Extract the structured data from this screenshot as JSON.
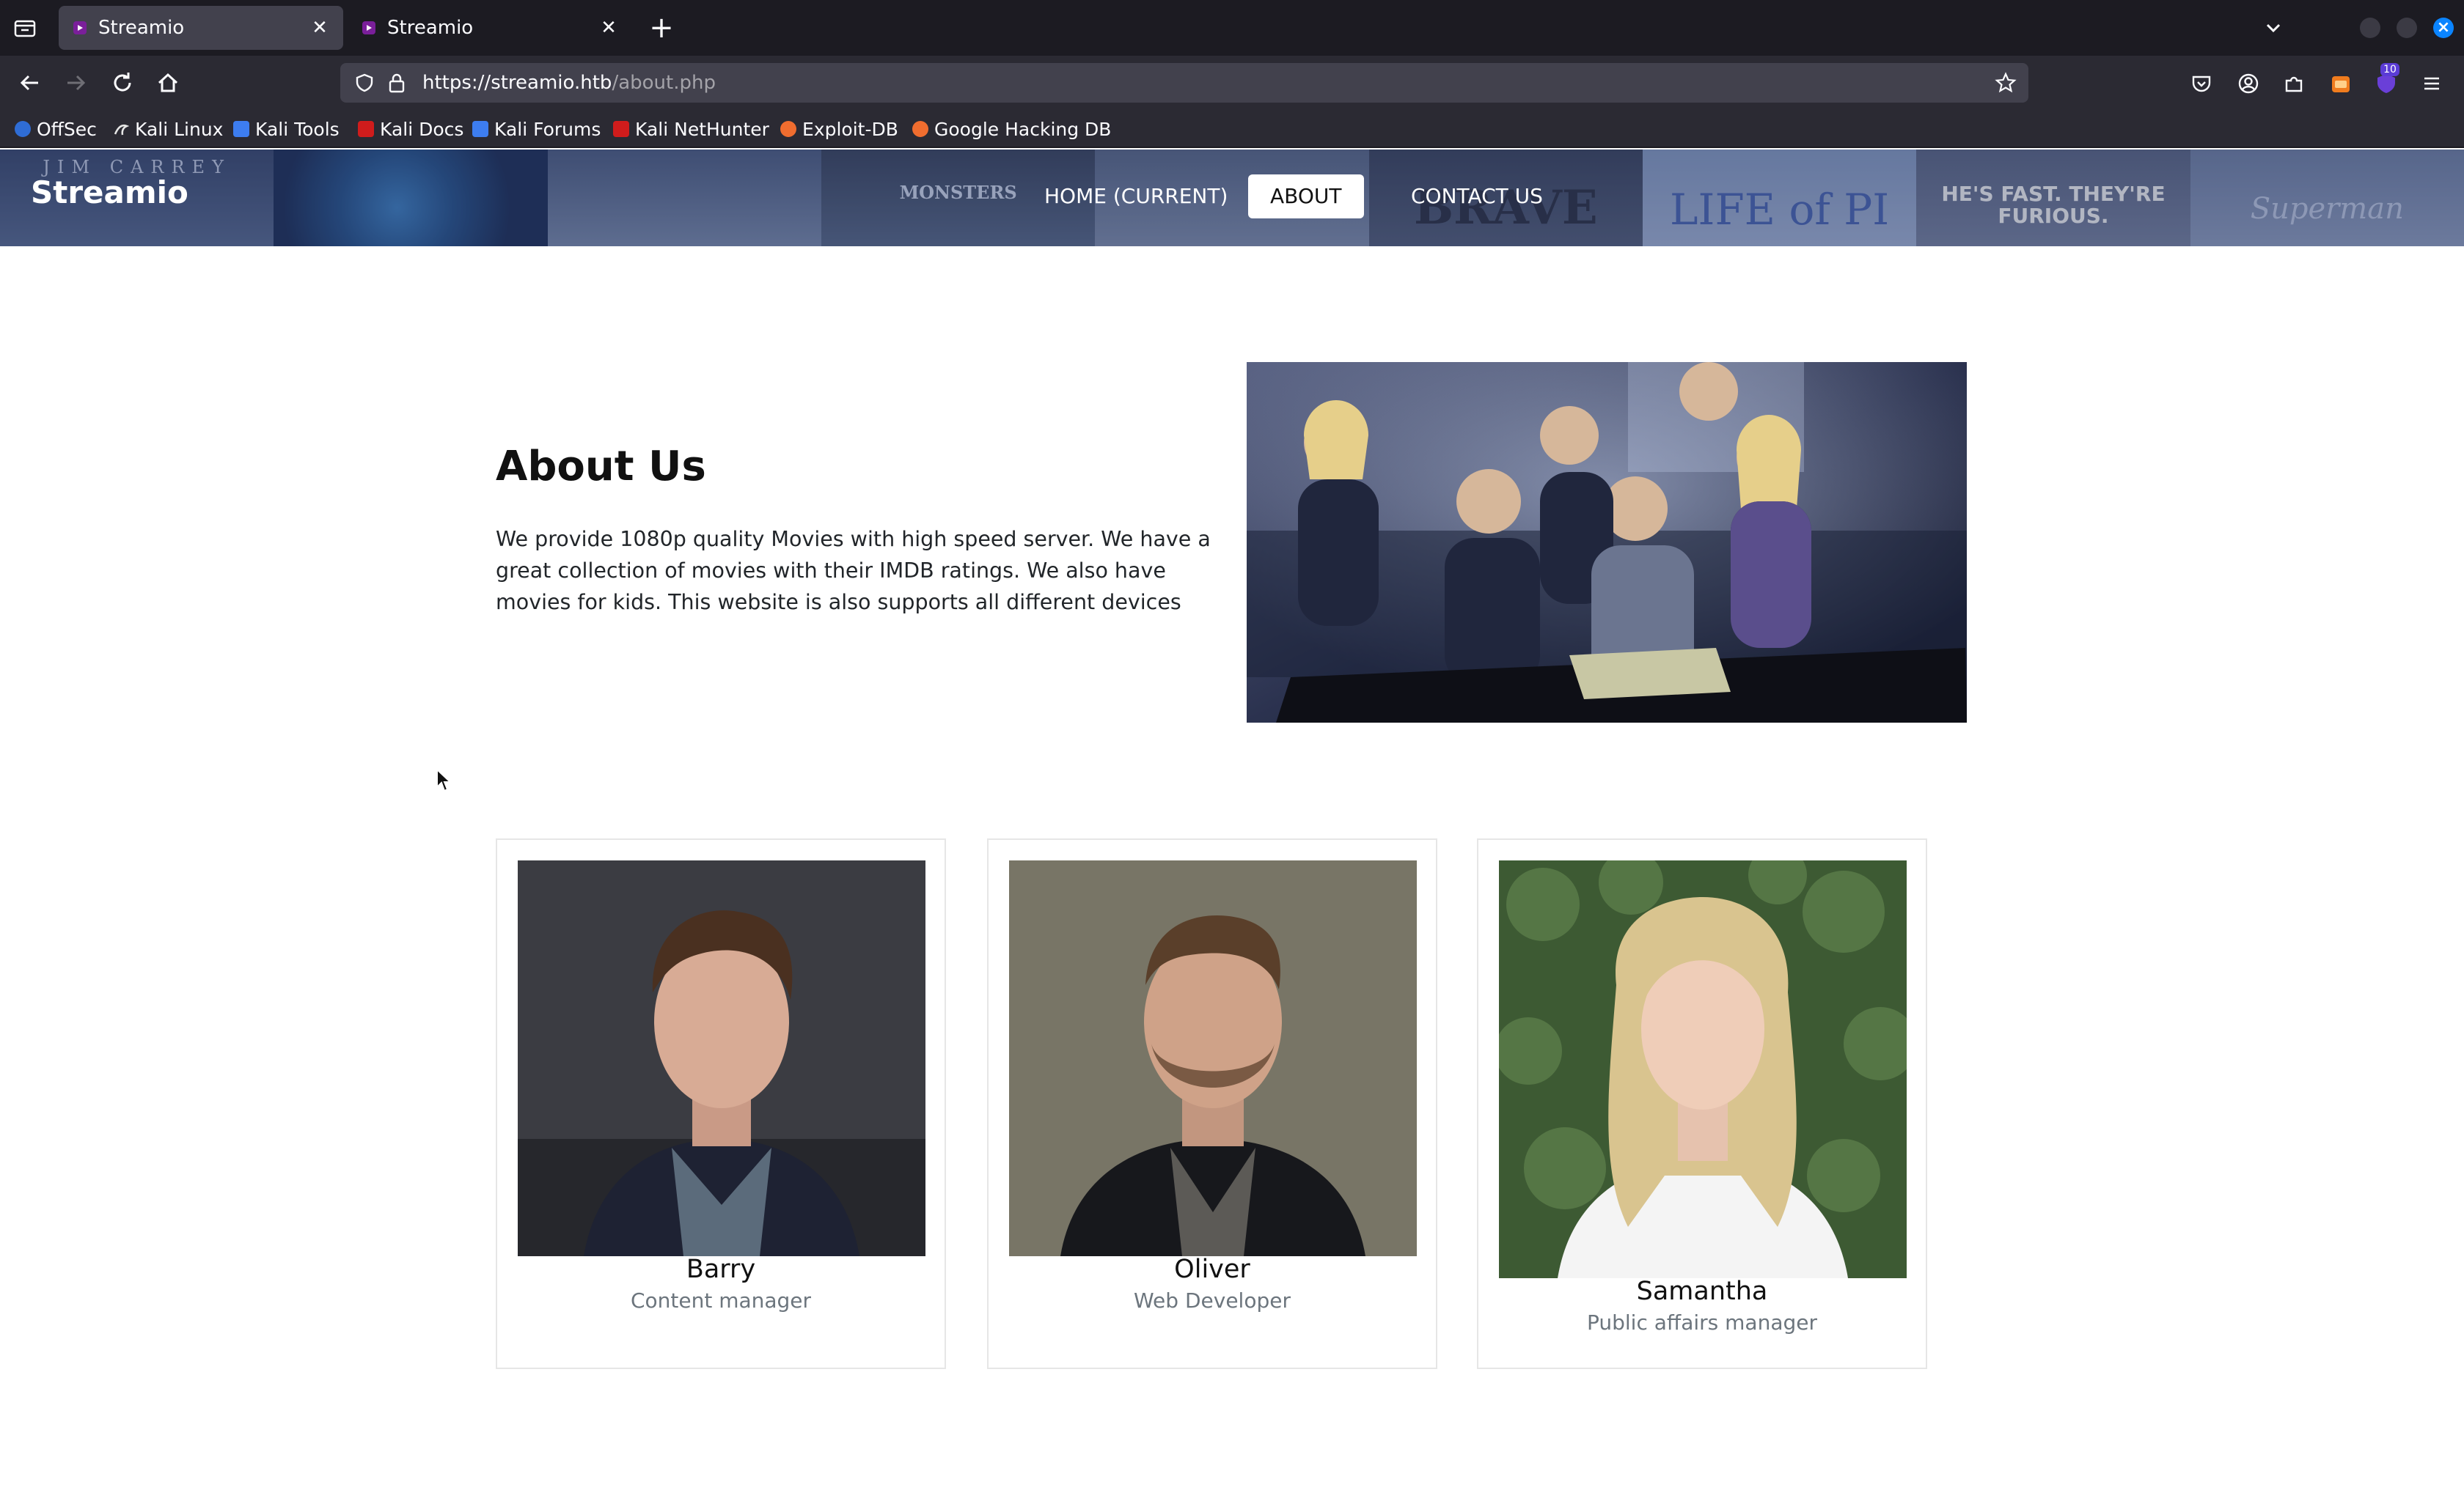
{
  "browser": {
    "tabs": [
      {
        "title": "Streamio",
        "active": true
      },
      {
        "title": "Streamio",
        "active": false
      }
    ],
    "url_host": "https://streamio.htb",
    "url_path": "/about.php",
    "extension_badge": "10",
    "bookmarks": [
      {
        "label": "OffSec",
        "icon_color": "#2f6dd6"
      },
      {
        "label": "Kali Linux",
        "icon_color": "#e6e6e6"
      },
      {
        "label": "Kali Tools",
        "icon_color": "#3d7df0"
      },
      {
        "label": "Kali Docs",
        "icon_color": "#d01c1c"
      },
      {
        "label": "Kali Forums",
        "icon_color": "#3d7df0"
      },
      {
        "label": "Kali NetHunter",
        "icon_color": "#d01c1c"
      },
      {
        "label": "Exploit-DB",
        "icon_color": "#f06d2f"
      },
      {
        "label": "Google Hacking DB",
        "icon_color": "#f06d2f"
      }
    ]
  },
  "site": {
    "brand": "Streamio",
    "nav": [
      {
        "label": "HOME (CURRENT)",
        "active": false
      },
      {
        "label": "ABOUT",
        "active": true
      },
      {
        "label": "CONTACT US",
        "active": false
      }
    ],
    "banner_posters": [
      "JIM CARREY",
      "",
      "",
      "MONSTERS",
      "",
      "BRAVE",
      "LIFE of PI",
      "HE'S FAST. THEY'RE FURIOUS.",
      "Superman"
    ]
  },
  "about": {
    "title": "About Us",
    "text": "We provide 1080p quality Movies with high speed server. We have a great collection of movies with their IMDB ratings. We also have movies for kids. This website is also supports all different devices"
  },
  "team": [
    {
      "name": "Barry",
      "role": "Content manager"
    },
    {
      "name": "Oliver",
      "role": "Web Developer"
    },
    {
      "name": "Samantha",
      "role": "Public affairs manager"
    }
  ],
  "colors": {
    "chrome_dark": "#1c1b22",
    "chrome_toolbar": "#2b2a33",
    "accent": "#0a84ff"
  }
}
